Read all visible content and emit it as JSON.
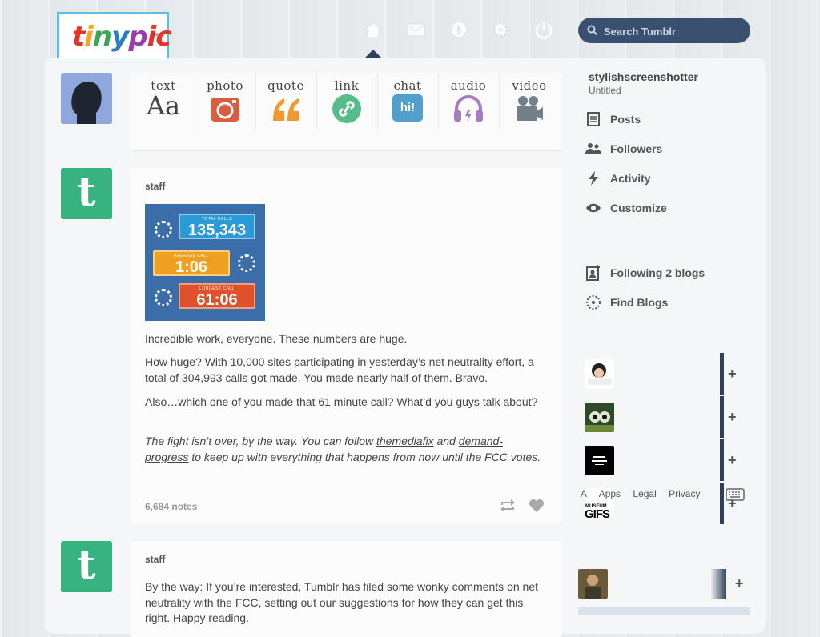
{
  "header": {
    "logo": "tinypic",
    "logo_tm": "™",
    "nav_icons": [
      "home-icon",
      "mail-icon",
      "compass-icon",
      "gear-icon",
      "power-icon"
    ],
    "search_placeholder": "Search Tumblr",
    "search_value": ""
  },
  "post_types": [
    {
      "label": "text",
      "icon": "text-icon",
      "color": "#444444"
    },
    {
      "label": "photo",
      "icon": "camera-icon",
      "color": "#d95e40"
    },
    {
      "label": "quote",
      "icon": "quote-icon",
      "color": "#f2992e"
    },
    {
      "label": "link",
      "icon": "link-icon",
      "color": "#56bc8a"
    },
    {
      "label": "chat",
      "icon": "chat-icon",
      "color": "#529ecc"
    },
    {
      "label": "audio",
      "icon": "headphones-icon",
      "color": "#a77dc2"
    },
    {
      "label": "video",
      "icon": "video-icon",
      "color": "#748089"
    }
  ],
  "text_icon_glyph": "Aa",
  "chat_icon_glyph": "hi!",
  "post1": {
    "author": "staff",
    "image": {
      "total_calls_label": "TOTAL CALLS",
      "total_calls": "135,343",
      "average_call_label": "AVERAGE CALL",
      "average_call": "1:06",
      "longest_call_label": "LONGEST CALL",
      "longest_call": "61:06"
    },
    "p1": "Incredible work, everyone. These numbers are huge.",
    "p2": "How huge? With 10,000 sites participating in yesterday’s net neutrality effort, a total of 304,993 calls got made. You made nearly half of them. Bravo.",
    "p3": "Also…which one of you made that 61 minute call? What’d you guys talk about?",
    "p4_a": "The fight isn’t over, by the way. You can follow ",
    "p4_link1": "themediafix",
    "p4_b": " and ",
    "p4_link2": "demand-progress",
    "p4_c": " to keep up with everything that happens from now until the FCC votes.",
    "notes": "6,684 notes"
  },
  "post2": {
    "author": "staff",
    "p1": "By the way: If you’re interested, Tumblr has filed some wonky comments on net neutrality with the FCC, setting out our suggestions for how they can get this right. Happy reading."
  },
  "sidebar": {
    "username": "stylishscreenshotter",
    "subtitle": "Untitled",
    "items": [
      {
        "label": "Posts",
        "icon": "posts-icon"
      },
      {
        "label": "Followers",
        "icon": "followers-icon"
      },
      {
        "label": "Activity",
        "icon": "lightning-icon"
      },
      {
        "label": "Customize",
        "icon": "eye-icon"
      }
    ],
    "items2": [
      {
        "label": "Following 2 blogs",
        "icon": "add-person-icon"
      },
      {
        "label": "Find Blogs",
        "icon": "compass-dotted-icon"
      }
    ],
    "recommended_plus": "+",
    "museum_label_1": "MUSEUM",
    "museum_label_2": "GIFS",
    "footer": [
      "A",
      "Apps",
      "Legal",
      "Privacy"
    ]
  }
}
